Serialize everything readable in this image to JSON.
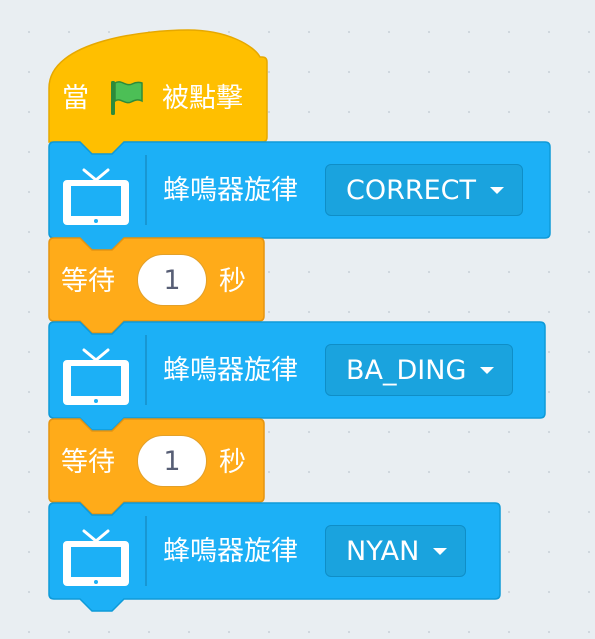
{
  "colors": {
    "event": "#ffbf00",
    "event_border": "#e6a800",
    "control": "#ffab19",
    "control_border": "#e59410",
    "action": "#1cb0f6",
    "action_border": "#0e9ad8",
    "canvas": "#e9eef2"
  },
  "hat_block": {
    "prefix": "當",
    "icon": "green-flag-icon",
    "suffix": "被點擊"
  },
  "blocks": [
    {
      "type": "action",
      "icon": "tv-icon",
      "label": "蜂鳴器旋律",
      "dropdown_value": "CORRECT"
    },
    {
      "type": "wait",
      "prefix": "等待",
      "value": "1",
      "suffix": "秒"
    },
    {
      "type": "action",
      "icon": "tv-icon",
      "label": "蜂鳴器旋律",
      "dropdown_value": "BA_DING"
    },
    {
      "type": "wait",
      "prefix": "等待",
      "value": "1",
      "suffix": "秒"
    },
    {
      "type": "action",
      "icon": "tv-icon",
      "label": "蜂鳴器旋律",
      "dropdown_value": "NYAN"
    }
  ]
}
